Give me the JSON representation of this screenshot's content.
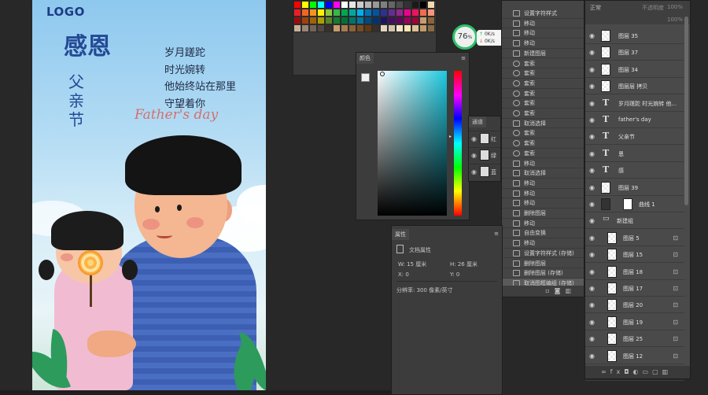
{
  "canvas": {
    "logo": "LOGO",
    "title_big": "感恩",
    "title_small": "父亲节",
    "poem": [
      "岁月蹉跎",
      "时光婉转",
      "他始终站在那里",
      "守望着你"
    ],
    "fathers_day": "Father's day"
  },
  "swatch_colors": [
    "#ff0000",
    "#ffff00",
    "#00ff00",
    "#00ffff",
    "#0000ff",
    "#ff00ff",
    "#ffffff",
    "#e6e6e6",
    "#cccccc",
    "#b3b3b3",
    "#999999",
    "#808080",
    "#666666",
    "#4d4d4d",
    "#333333",
    "#1a1a1a",
    "#000000",
    "#f2d9b0",
    "#ee1d24",
    "#f26522",
    "#f7941d",
    "#fff200",
    "#8dc63f",
    "#39b54a",
    "#00a651",
    "#00a99d",
    "#00aeef",
    "#0072bc",
    "#0054a6",
    "#2e3192",
    "#662d91",
    "#92278f",
    "#ec008c",
    "#ed145b",
    "#f26c4f",
    "#f69679",
    "#9e0b0f",
    "#a0410d",
    "#a36209",
    "#aba000",
    "#598527",
    "#197b30",
    "#007236",
    "#00746b",
    "#0076a3",
    "#004a80",
    "#003471",
    "#1b1464",
    "#440e62",
    "#630460",
    "#9e005d",
    "#9e0039",
    "#c69c6d",
    "#8c6239",
    "#c7b299",
    "#998675",
    "#736357",
    "#534741",
    "#37302a",
    "#c69c6d",
    "#a67c52",
    "#8c6239",
    "#754c24",
    "#603913",
    "#362f2d",
    "#e2d4c4",
    "#d3c2ae",
    "#f5e6c8",
    "#ffe5b4",
    "#e0c097",
    "#c29a6b",
    "#8a6a45"
  ],
  "color_panel": {
    "tab": "颜色"
  },
  "zoom": {
    "value": "76",
    "unit": "%"
  },
  "net_speed": {
    "up": "0K/s",
    "down": "0K/s"
  },
  "channels": {
    "tab": "通道",
    "items": [
      "红",
      "绿",
      "蓝"
    ]
  },
  "history": {
    "items": [
      "设置字符样式",
      "移动",
      "移动",
      "移动",
      "新建图层",
      "套索",
      "套索",
      "套索",
      "套索",
      "套索",
      "套索",
      "取消选择",
      "套索",
      "套索",
      "套索",
      "移动",
      "取消选择",
      "移动",
      "移动",
      "移动",
      "删除图层",
      "移动",
      "自由变换",
      "移动",
      "设置字符样式 (存储)",
      "删除图层",
      "删除图层 (存储)",
      "取消图框编组 (存储)"
    ]
  },
  "properties": {
    "tab": "属性",
    "doc_label": "文档属性",
    "w": "W: 15 厘米",
    "h": "H: 26 厘米",
    "x": "X: 0",
    "y": "Y: 0",
    "resolution": "分辨率: 300 像素/英寸"
  },
  "layers": {
    "blend_mode": "正常",
    "opacity_label": "不透明度",
    "opacity_value": "100%",
    "fill_value": "100%",
    "items": [
      {
        "name": "图层 35",
        "kind": "pixel"
      },
      {
        "name": "图层 37",
        "kind": "pixel"
      },
      {
        "name": "图层 34",
        "kind": "pixel"
      },
      {
        "name": "图层层 拷贝",
        "kind": "pixel"
      },
      {
        "name": "岁月蹉跎 时光婉转 他...",
        "kind": "text"
      },
      {
        "name": "father's day",
        "kind": "text"
      },
      {
        "name": "父亲节",
        "kind": "text"
      },
      {
        "name": "恩",
        "kind": "text"
      },
      {
        "name": "感",
        "kind": "text"
      },
      {
        "name": "图层 39",
        "kind": "pixel"
      },
      {
        "name": "曲线 1",
        "kind": "adjust"
      },
      {
        "name": "新建组",
        "kind": "group"
      },
      {
        "name": "图层 5",
        "kind": "pixel"
      },
      {
        "name": "图层 15",
        "kind": "pixel"
      },
      {
        "name": "图层 18",
        "kind": "pixel"
      },
      {
        "name": "图层 17",
        "kind": "pixel"
      },
      {
        "name": "图层 20",
        "kind": "pixel"
      },
      {
        "name": "图层 19",
        "kind": "pixel"
      },
      {
        "name": "图层 25",
        "kind": "pixel"
      },
      {
        "name": "图层 12",
        "kind": "pixel"
      },
      {
        "name": "图层 13",
        "kind": "pixel"
      }
    ]
  }
}
